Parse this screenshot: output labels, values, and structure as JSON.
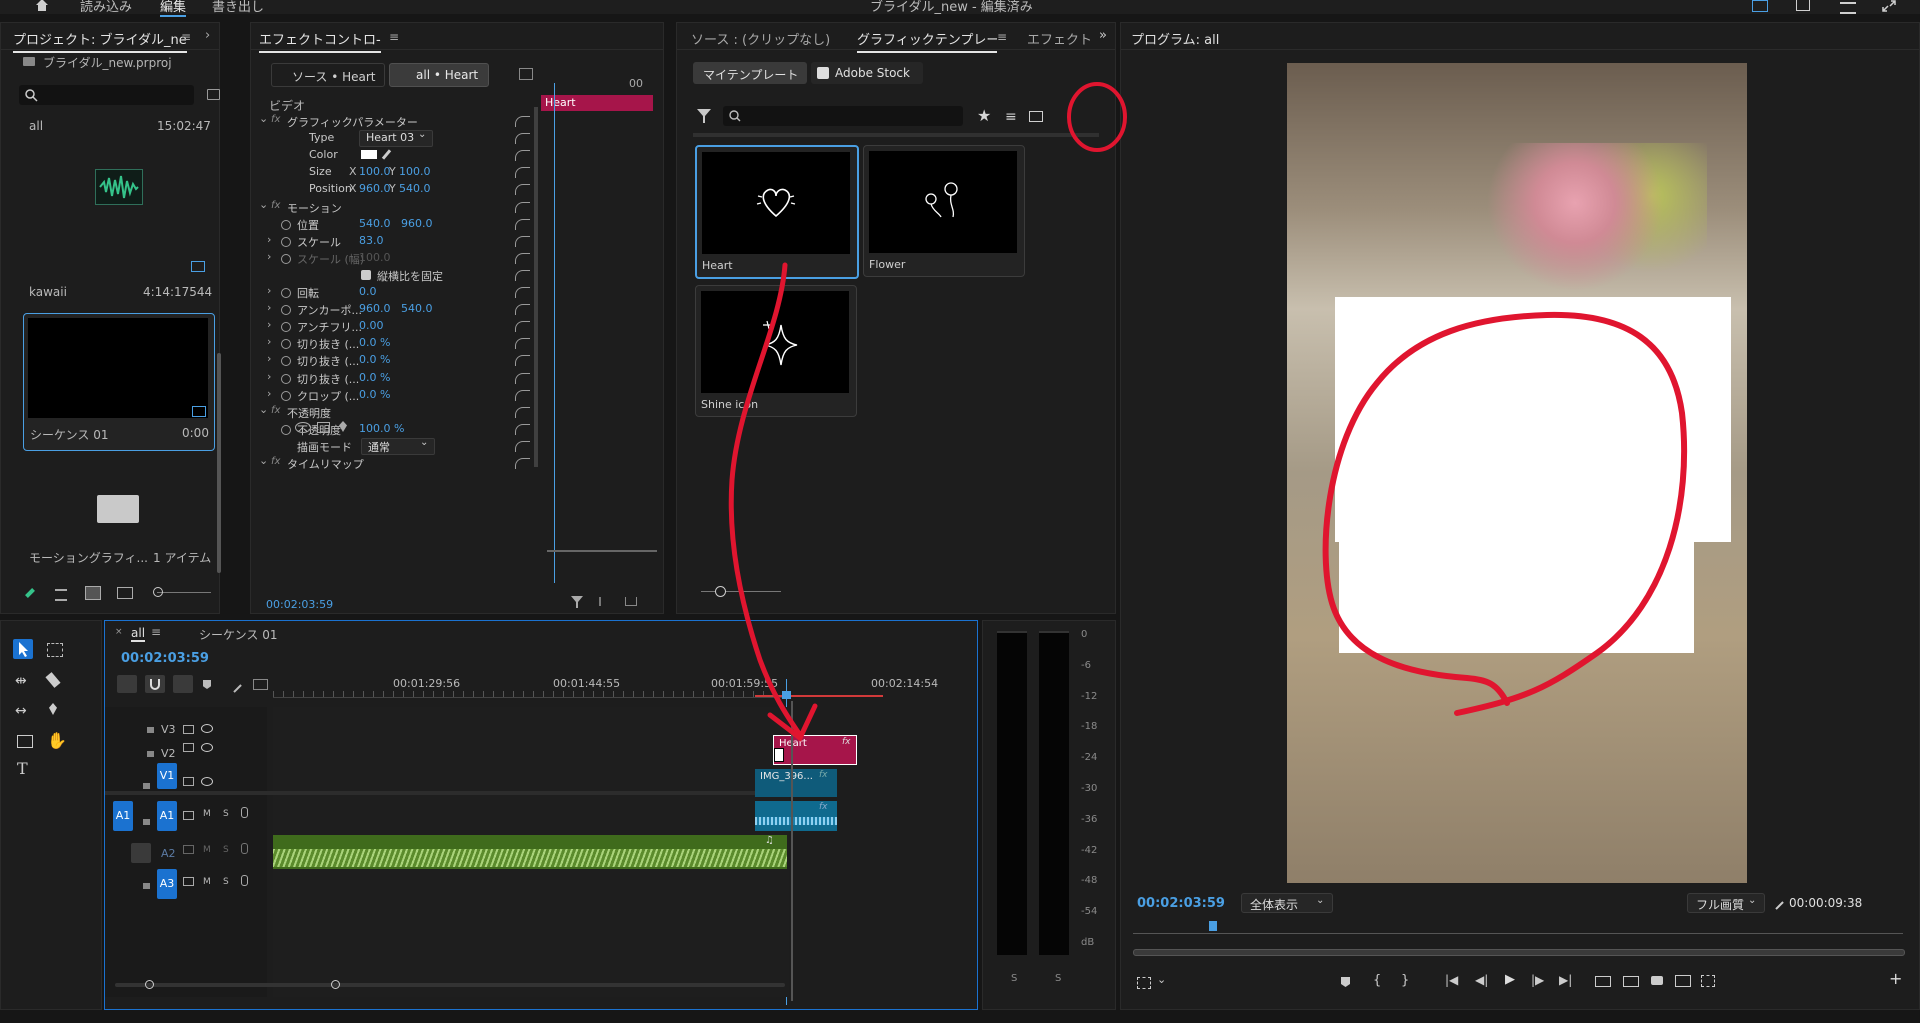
{
  "menu": {
    "items": [
      "読み込み",
      "編集",
      "書き出し"
    ],
    "active": "編集",
    "doc_title": "ブライダル_new - 編集済み"
  },
  "project_panel": {
    "tab_label": "プロジェクト: ブライダル_ne",
    "file_name": "ブライダル_new.prproj",
    "items": [
      {
        "name": "all",
        "duration": "15:02:47"
      },
      {
        "name": "kawaii",
        "duration": "4:14:17544"
      },
      {
        "name": "シーケンス 01",
        "duration": "0:00"
      },
      {
        "name": "モーショングラフィ...",
        "duration": "1 アイテム"
      }
    ]
  },
  "effect_controls": {
    "tab_label": "エフェクトコントロ-",
    "source_chip": "ソース • Heart",
    "seq_chip": "all • Heart",
    "section_video": "ビデオ",
    "clip_label": "Heart",
    "rows": [
      {
        "label": "グラフィックパラメーター",
        "type": "group"
      },
      {
        "label": "Type",
        "value": "Heart 03"
      },
      {
        "label": "Color",
        "value": ""
      },
      {
        "label": "Size",
        "x": "100.0",
        "y": "100.0"
      },
      {
        "label": "Position",
        "x": "960.0",
        "y": "540.0"
      },
      {
        "label": "モーション",
        "type": "group"
      },
      {
        "label": "位置",
        "v1": "540.0",
        "v2": "960.0"
      },
      {
        "label": "スケール",
        "v1": "83.0"
      },
      {
        "label": "スケール (幅)",
        "v1": "100.0"
      },
      {
        "label": "縦横比を固定",
        "v1": ""
      },
      {
        "label": "回転",
        "v1": "0.0"
      },
      {
        "label": "アンカーポ...",
        "v1": "960.0",
        "v2": "540.0"
      },
      {
        "label": "アンチフリ...",
        "v1": "0.00"
      },
      {
        "label": "切り抜き (...",
        "v1": "0.0 %"
      },
      {
        "label": "切り抜き (...",
        "v1": "0.0 %"
      },
      {
        "label": "切り抜き (...",
        "v1": "0.0 %"
      },
      {
        "label": "クロップ (...",
        "v1": "0.0 %"
      },
      {
        "label": "不透明度",
        "type": "group"
      },
      {
        "label": "不透明度",
        "v1": "100.0 %"
      },
      {
        "label": "描画モード",
        "v1": "通常"
      },
      {
        "label": "タイムリマップ",
        "type": "group"
      }
    ],
    "timecode": "00:02:03:59",
    "mini_ruler": "00"
  },
  "graphics_panel": {
    "tabs": [
      "ソース : (クリップなし)",
      "グラフィックテンプレート",
      "エフェクト"
    ],
    "sub_tabs": [
      "マイテンプレート",
      "Adobe Stock"
    ],
    "templates": [
      {
        "name": "Heart"
      },
      {
        "name": "Flower"
      },
      {
        "name": "Shine icon"
      }
    ]
  },
  "program_monitor": {
    "title": "プログラム: all",
    "timecode": "00:02:03:59",
    "fit": "全体表示",
    "quality": "フル画質",
    "duration": "00:00:09:38"
  },
  "timeline": {
    "tabs": [
      "all",
      "シーケンス 01"
    ],
    "timecode": "00:02:03:59",
    "ruler": [
      "00:01:29:56",
      "00:01:44:55",
      "00:01:59:55",
      "00:02:14:54"
    ],
    "tracks": [
      "V3",
      "V2",
      "V1",
      "A1",
      "A2",
      "A3"
    ],
    "clips": {
      "heart": "Heart",
      "video": "IMG_396...",
      "fx": "fx"
    }
  },
  "audio_meter": {
    "labels": [
      "0",
      "-6",
      "-12",
      "-18",
      "-24",
      "-30",
      "-36",
      "-42",
      "-48",
      "-54",
      "dB"
    ],
    "solo": [
      "S",
      "S"
    ]
  },
  "colors": {
    "accent": "#4a9fe3",
    "clip_heart": "#a6154a",
    "clip_video": "#0f5b7a",
    "audio": "#6f9a3a",
    "annotation": "#e0152f"
  }
}
